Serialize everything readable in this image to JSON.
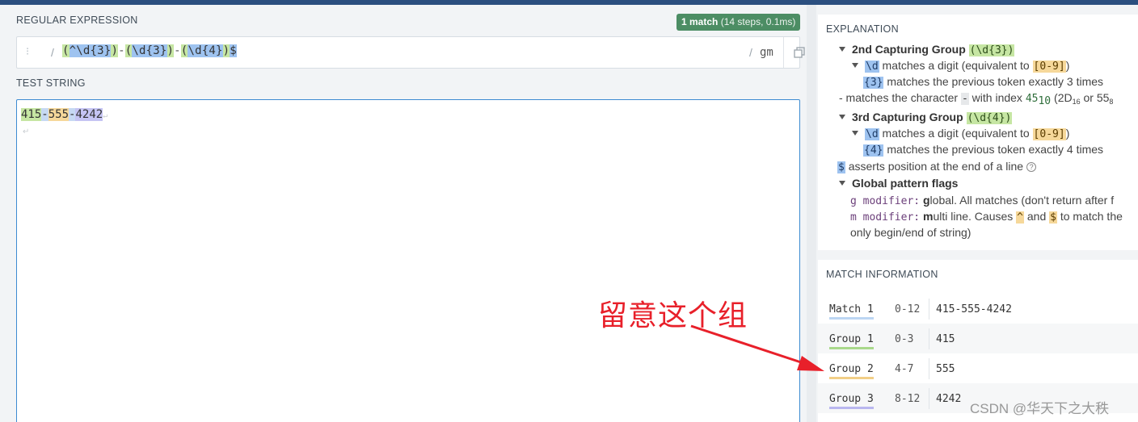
{
  "editor": {
    "regex_label": "REGULAR EXPRESSION",
    "badge_count": "1 match",
    "badge_detail": "(14 steps, 0.1ms)",
    "delimiter_open": "/",
    "delimiter_close": "/",
    "flags": "gm",
    "pattern_tokens": [
      "(",
      "^",
      "\\d{3}",
      ")",
      "-",
      "(",
      "\\d{3}",
      ")",
      "-",
      "(",
      "\\d{4}",
      ")",
      "$"
    ],
    "test_label": "TEST STRING",
    "test_parts": [
      "415",
      "-",
      "555",
      "-",
      "4242"
    ],
    "line_break_symbol": "↵"
  },
  "explanation": {
    "title": "EXPLANATION",
    "g2_title": "2nd Capturing Group",
    "g2_token": "(\\d{3})",
    "d_token": "\\d",
    "d_text_before": "matches a digit (equivalent to",
    "range_token": "[0-9]",
    "close_paren": ")",
    "q3_token": "{3}",
    "q3_text": "matches the previous token exactly 3 times",
    "dash_text_before": "- matches the character",
    "dash_token": "-",
    "dash_text_mid": "with index",
    "idx_num": "45",
    "idx_base10": "10",
    "idx_hex_open": "(2D",
    "idx_base16": "16",
    "idx_or": "or 55",
    "idx_base8": "8",
    "g3_title": "3rd Capturing Group",
    "g3_token": "(\\d{4})",
    "q4_token": "{4}",
    "q4_text": "matches the previous token exactly 4 times",
    "end_token": "$",
    "end_text": "asserts position at the end of a line",
    "help_symbol": "?",
    "flags_title": "Global pattern flags",
    "g_mod": "g modifier:",
    "g_bold": "g",
    "g_text": "lobal. All matches (don't return after f",
    "m_mod": "m modifier:",
    "m_bold": "m",
    "m_text_before": "ulti line. Causes",
    "caret_token": "^",
    "and_text": "and",
    "m_text_after": "to match the",
    "m_text_line2": "only begin/end of string)"
  },
  "match_info": {
    "title": "MATCH INFORMATION",
    "rows": [
      {
        "name": "Match 1",
        "range": "0-12",
        "value": "415-555-4242"
      },
      {
        "name": "Group 1",
        "range": "0-3",
        "value": "415"
      },
      {
        "name": "Group 2",
        "range": "4-7",
        "value": "555"
      },
      {
        "name": "Group 3",
        "range": "8-12",
        "value": "4242"
      }
    ]
  },
  "annotation": {
    "text": "留意这个组"
  },
  "watermark": {
    "text": "CSDN @华天下之大秩"
  },
  "colors": {
    "top_bar": "#2b4f7f",
    "badge": "#4c8d64",
    "group_green": "#c6e6a3",
    "group_blue": "#9ec3f0",
    "group_yellow": "#f6d89a",
    "group_purple": "#c5c4f3",
    "annotation": "#e8202a"
  },
  "icons": [
    "drag-handle-icon",
    "copy-icon",
    "collapse-triangle-icon",
    "help-icon",
    "arrow-annotation"
  ]
}
